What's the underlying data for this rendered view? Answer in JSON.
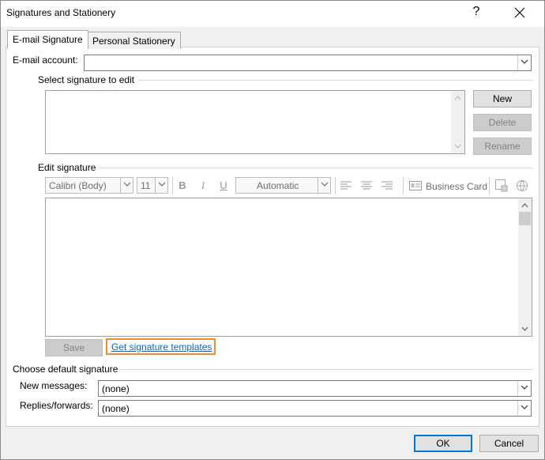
{
  "window": {
    "title": "Signatures and Stationery",
    "help_label": "?",
    "close_label": "✕"
  },
  "tabs": [
    {
      "label": "E-mail Signature",
      "active": true
    },
    {
      "label": "Personal Stationery",
      "active": false
    }
  ],
  "email_account": {
    "label": "E-mail account:",
    "value": ""
  },
  "select_signature": {
    "label": "Select signature to edit",
    "items": [],
    "buttons": {
      "new": "New",
      "delete": "Delete",
      "rename": "Rename"
    }
  },
  "edit_signature": {
    "label": "Edit signature",
    "font_family": "Calibri (Body)",
    "font_size": "11",
    "bold": "B",
    "italic": "I",
    "underline": "U",
    "color": "Automatic",
    "business_card": "Business Card",
    "content": ""
  },
  "save_label": "Save",
  "templates_link": "Get signature templates",
  "default_signature": {
    "label": "Choose default signature",
    "new_messages_label": "New messages:",
    "new_messages_value": "(none)",
    "replies_label": "Replies/forwards:",
    "replies_value": "(none)"
  },
  "footer": {
    "ok": "OK",
    "cancel": "Cancel"
  },
  "colors": {
    "accent": "#0078d7",
    "highlight": "#f08c2c",
    "link": "#0066cc"
  }
}
